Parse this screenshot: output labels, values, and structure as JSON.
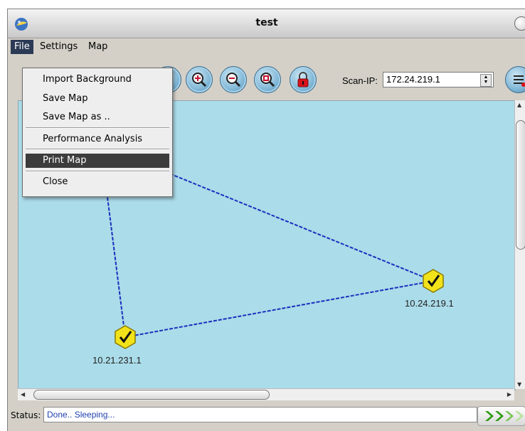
{
  "window": {
    "title": "test"
  },
  "menubar": {
    "items": [
      "File",
      "Settings",
      "Map"
    ],
    "active": "File"
  },
  "file_menu": {
    "items": [
      "Import Background",
      "Save Map",
      "Save Map as ..",
      "Performance Analysis",
      "Print Map",
      "Close"
    ],
    "highlighted": "Print Map"
  },
  "toolbar": {
    "buttons": [
      "zoom-in-icon",
      "zoom-out-icon",
      "zoom-reset-icon",
      "lock-icon"
    ],
    "scan_ip_label": "Scan-IP:",
    "scan_ip_value": "172.24.219.1"
  },
  "map": {
    "background_color": "#abdce9",
    "link_color": "#1a2fbf",
    "nodes": [
      {
        "id": "10.24.219.1",
        "label": "10.24.219.1",
        "status": "ok"
      },
      {
        "id": "10.21.231.1",
        "label": "10.21.231.1",
        "status": "ok"
      }
    ]
  },
  "statusbar": {
    "label": "Status:",
    "text": "Done.. Sleeping..."
  }
}
